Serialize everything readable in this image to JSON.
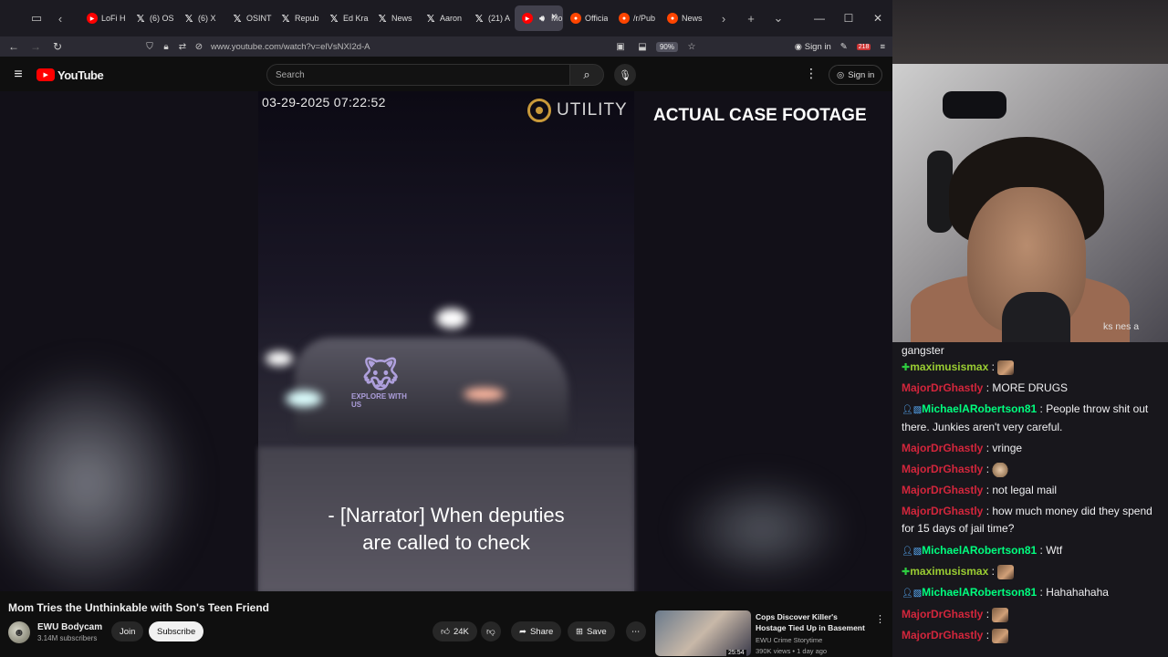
{
  "browser": {
    "tabs": [
      {
        "label": "LoFi H",
        "icon": "youtube-icon",
        "active": false
      },
      {
        "label": "(6) OS",
        "icon": "x-icon",
        "active": false
      },
      {
        "label": "(6) X",
        "icon": "x-icon",
        "active": false
      },
      {
        "label": "OSINT",
        "icon": "x-icon",
        "active": false
      },
      {
        "label": "Repub",
        "icon": "x-icon",
        "active": false
      },
      {
        "label": "Ed Kra",
        "icon": "x-icon",
        "active": false
      },
      {
        "label": "News",
        "icon": "x-icon",
        "active": false
      },
      {
        "label": "Aaron",
        "icon": "x-icon",
        "active": false
      },
      {
        "label": "(21) A",
        "icon": "x-icon",
        "active": false
      },
      {
        "label": "Mo",
        "icon": "youtube-icon",
        "active": true
      },
      {
        "label": "Officia",
        "icon": "reddit-icon",
        "active": false
      },
      {
        "label": "/r/Pub",
        "icon": "reddit-icon",
        "active": false
      },
      {
        "label": "News",
        "icon": "reddit-icon",
        "active": false
      }
    ],
    "url": "www.youtube.com/watch?v=elVsNXI2d-A",
    "zoom": "90%",
    "signin": "Sign in",
    "extension_badge": "218"
  },
  "youtube": {
    "logo_text": "YouTube",
    "search_placeholder": "Search",
    "signin": "Sign in"
  },
  "video": {
    "timestamp": "03-29-2025 07:22:52",
    "watermark": "UTILITY",
    "overlay_title": "ACTUAL CASE FOOTAGE",
    "wolf_text": "EXPLORE WITH US",
    "caption_line1": "- [Narrator] When deputies",
    "caption_line2": "are called to check"
  },
  "meta": {
    "title": "Mom Tries the Unthinkable with Son's Teen Friend",
    "channel": "EWU Bodycam",
    "subscribers": "3.14M subscribers",
    "join": "Join",
    "subscribe": "Subscribe",
    "likes": "24K",
    "share": "Share",
    "save": "Save"
  },
  "recommendation": {
    "title": "Cops Discover Killer's Hostage Tied Up in Basement",
    "channel": "EWU Crime Storytime",
    "meta": "390K views • 1 day ago",
    "duration": "25:54"
  },
  "stream": {
    "cam_overlay_text": "ks nes a",
    "chat": [
      {
        "text": "gangster",
        "continuation": true
      },
      {
        "user": "maximusismax",
        "badge": "plus",
        "emote": true,
        "text": ""
      },
      {
        "user": "MajorDrGhastly",
        "text": "MORE DRUGS"
      },
      {
        "user": "MichaelARobertson81",
        "badge": "pp",
        "text": "People throw shit out there. Junkies aren't very careful."
      },
      {
        "user": "MajorDrGhastly",
        "text": "vringe"
      },
      {
        "user": "MajorDrGhastly",
        "emote": true,
        "text": ""
      },
      {
        "user": "MajorDrGhastly",
        "text": "not legal mail"
      },
      {
        "user": "MajorDrGhastly",
        "text": "how much money did they spend for 15 days of jail time?"
      },
      {
        "user": "MichaelARobertson81",
        "badge": "pp",
        "text": "Wtf"
      },
      {
        "user": "maximusismax",
        "badge": "plus",
        "emote": true,
        "text": ""
      },
      {
        "user": "MichaelARobertson81",
        "badge": "pp",
        "text": "Hahahahaha"
      },
      {
        "user": "MajorDrGhastly",
        "emote": true,
        "text": ""
      },
      {
        "user": "MajorDrGhastly",
        "emote": true,
        "text": ""
      }
    ]
  }
}
